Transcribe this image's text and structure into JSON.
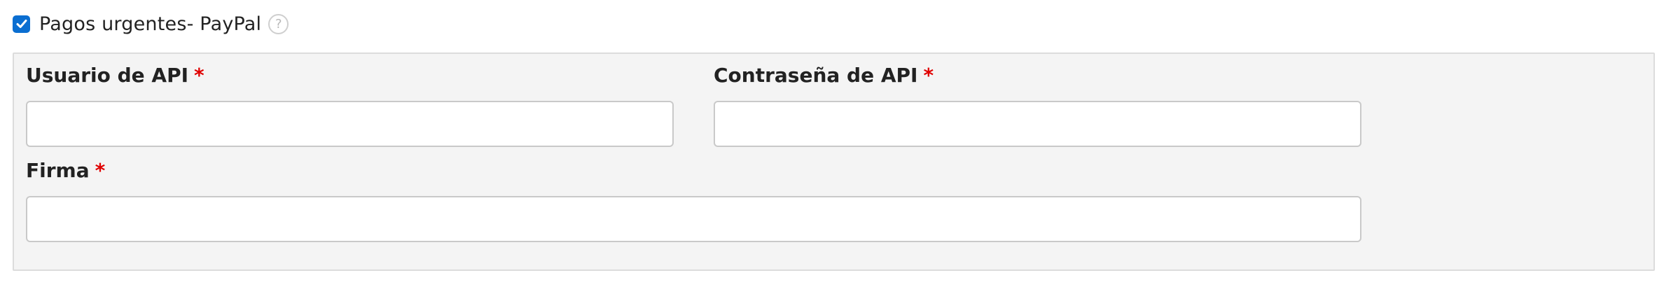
{
  "header": {
    "checked": true,
    "label": "Pagos urgentes- PayPal",
    "help_glyph": "?"
  },
  "form": {
    "api_user": {
      "label": "Usuario de API",
      "required_mark": "*",
      "value": "",
      "placeholder": ""
    },
    "api_password": {
      "label": "Contraseña de API",
      "required_mark": "*",
      "value": "",
      "placeholder": ""
    },
    "signature": {
      "label": "Firma",
      "required_mark": "*",
      "value": "",
      "placeholder": ""
    }
  },
  "colors": {
    "checkbox": "#0a6ed1",
    "required": "#e00000",
    "panel_bg": "#f4f4f4"
  },
  "icons": {
    "checkbox": "checkmark-icon",
    "help": "help-icon"
  }
}
